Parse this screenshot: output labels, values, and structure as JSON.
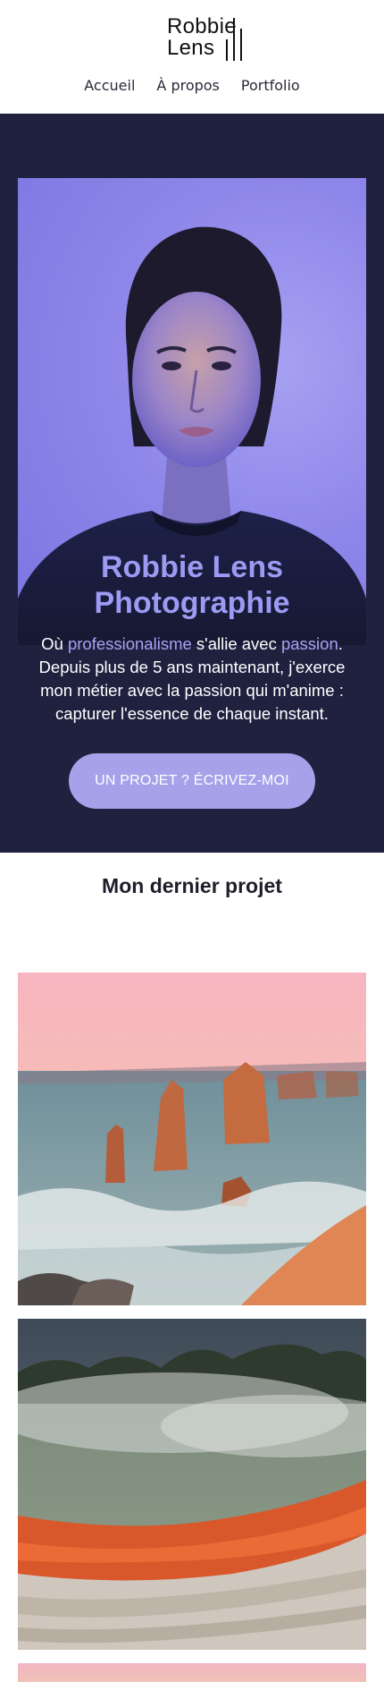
{
  "header": {
    "logo": {
      "line1": "Robbie",
      "line2": "Lens"
    },
    "nav": [
      {
        "label": "Accueil"
      },
      {
        "label": "À propos"
      },
      {
        "label": "Portfolio"
      }
    ]
  },
  "hero": {
    "title": "Robbie Lens Photographie",
    "text_parts": {
      "p1": "Où ",
      "accent1": "professionalisme",
      "p2": " s'allie avec ",
      "accent2": "passion",
      "p3": ". Depuis plus de 5 ans maintenant, j'exerce mon métier avec la passion qui m'anime : capturer l'essence de chaque instant."
    },
    "cta_label": "UN PROJET ? ÉCRIVEZ-MOI",
    "colors": {
      "background": "#20213f",
      "accent": "#9c9bf3",
      "button": "#a6a2ea"
    }
  },
  "projects": {
    "title": "Mon dernier projet"
  }
}
